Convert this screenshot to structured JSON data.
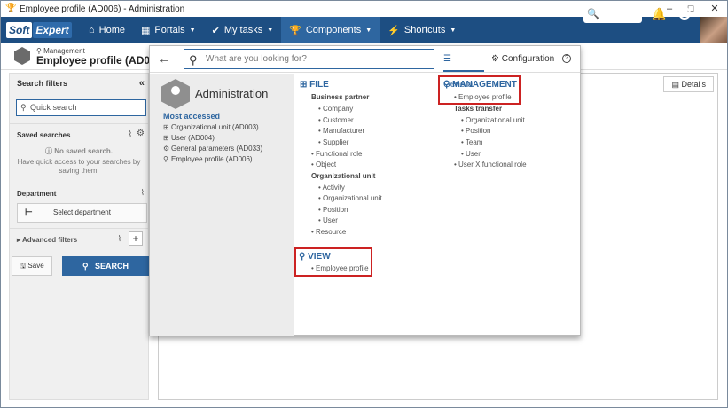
{
  "window": {
    "title": "Employee profile (AD006) - Administration",
    "controls": [
      "–",
      "☐",
      "✕"
    ]
  },
  "topnav": {
    "logo_left": "Soft",
    "logo_right": "Expert",
    "items": [
      {
        "label": "Home",
        "icon": "home-icon"
      },
      {
        "label": "Portals",
        "icon": "grid-icon"
      },
      {
        "label": "My tasks",
        "icon": "check-icon"
      },
      {
        "label": "Components",
        "icon": "trophy-icon"
      },
      {
        "label": "Shortcuts",
        "icon": "lightning-icon"
      }
    ]
  },
  "header": {
    "breadcrumb": "Management",
    "title": "Employee profile (AD006)"
  },
  "sidebar": {
    "search_filters": "Search filters",
    "quick_search_placeholder": "Quick search",
    "saved_searches": "Saved searches",
    "no_saved": "No saved search.",
    "no_saved_hint_1": "Have quick access to your searches by",
    "no_saved_hint_2": "saving them.",
    "department": "Department",
    "select_department": "Select department",
    "advanced_filters": "Advanced filters",
    "save": "Save",
    "search": "SEARCH"
  },
  "main": {
    "details_tab": "Details"
  },
  "dropdown": {
    "search_placeholder": "What are you looking for?",
    "tab_general": "General",
    "tab_configuration": "Configuration",
    "left": {
      "title": "Administration",
      "most_accessed_label": "Most accessed",
      "most_accessed": [
        {
          "icon": "plus-box-icon",
          "label": "Organizational unit (AD003)"
        },
        {
          "icon": "plus-box-icon",
          "label": "User (AD004)"
        },
        {
          "icon": "gear-icon",
          "label": "General parameters (AD033)"
        },
        {
          "icon": "pin-icon",
          "label": "Employee profile (AD006)"
        }
      ]
    },
    "file": {
      "heading": "FILE",
      "business_partner": "Business partner",
      "bp_items": [
        "Company",
        "Customer",
        "Manufacturer",
        "Supplier"
      ],
      "functional_role": "Functional role",
      "object": "Object",
      "org_unit": "Organizational unit",
      "ou_items": [
        "Activity",
        "Organizational unit",
        "Position",
        "User"
      ],
      "resource": "Resource"
    },
    "view": {
      "heading": "VIEW",
      "items": [
        "Employee profile"
      ]
    },
    "management": {
      "heading": "MANAGEMENT",
      "employee_profile": "Employee profile",
      "tasks_transfer": "Tasks transfer",
      "tt_items": [
        "Organizational unit",
        "Position",
        "Team",
        "User"
      ],
      "user_x_role": "User X functional role"
    }
  }
}
